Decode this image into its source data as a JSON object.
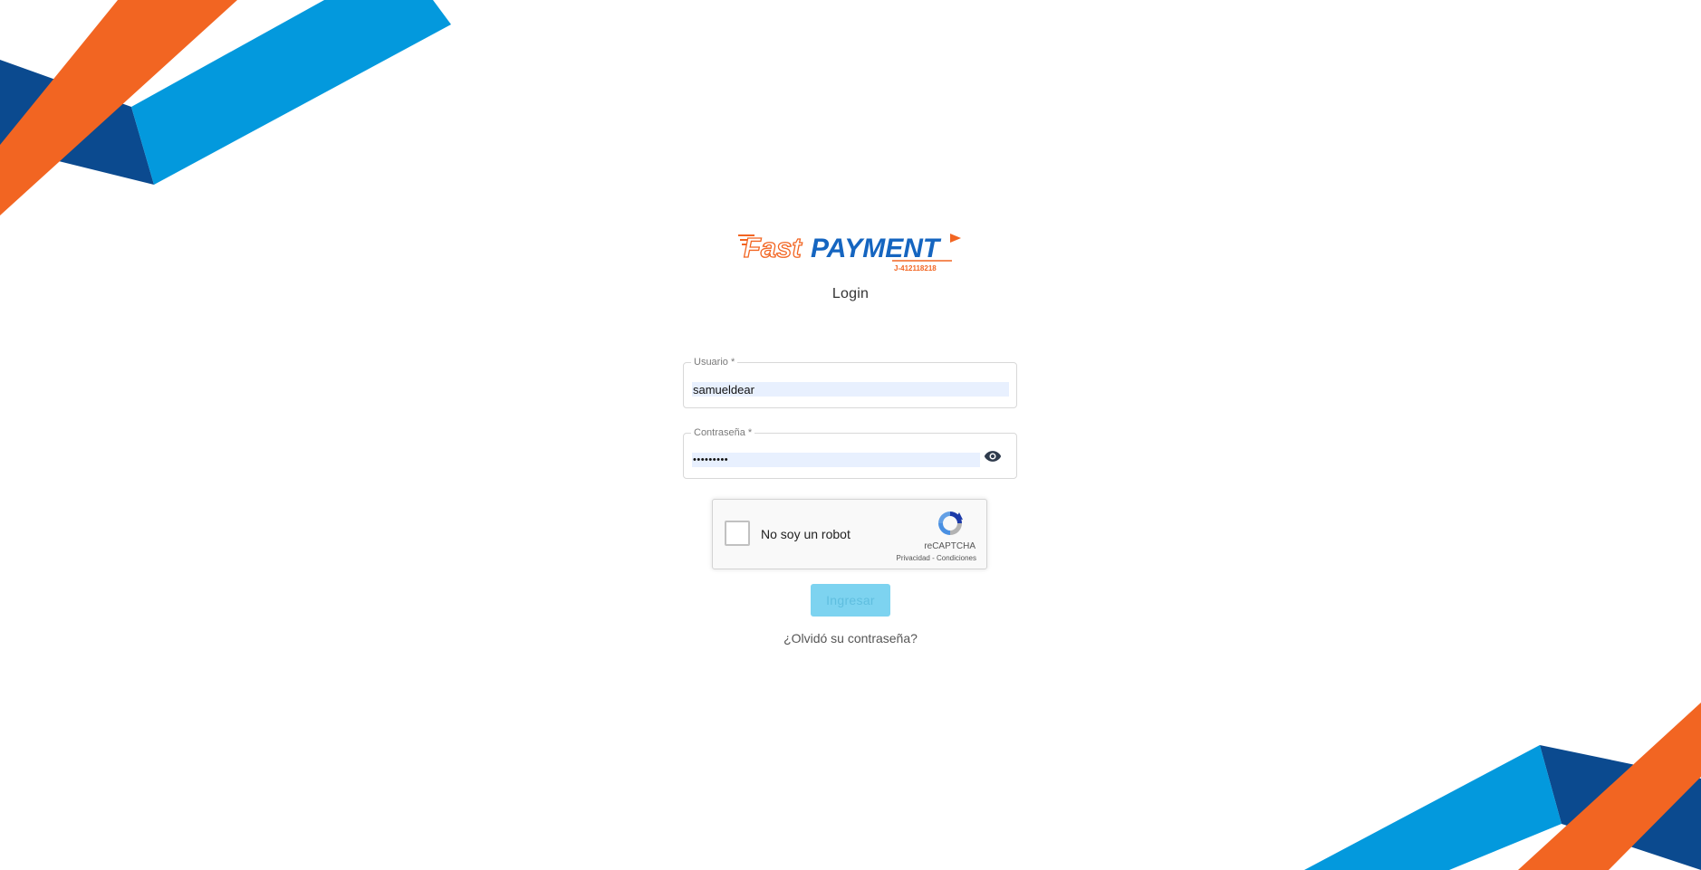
{
  "brand": {
    "name_part1": "Fast",
    "name_part2": "PAYMENT",
    "rif": "J-412118218",
    "colors": {
      "orange": "#f26522",
      "blue": "#1565c0",
      "light_blue": "#0399dd",
      "dark_blue": "#0b4a8f"
    }
  },
  "login": {
    "title": "Login",
    "username": {
      "label": "Usuario *",
      "value": "samueldear"
    },
    "password": {
      "label": "Contraseña *",
      "value": "•••••••••",
      "toggle_icon": "eye-icon"
    },
    "captcha": {
      "label": "No soy un robot",
      "brand": "reCAPTCHA",
      "privacy": "Privacidad",
      "separator": " - ",
      "terms": "Condiciones",
      "icon": "recaptcha-logo-icon"
    },
    "submit_label": "Ingresar",
    "forgot_label": "¿Olvidó su contraseña?"
  }
}
